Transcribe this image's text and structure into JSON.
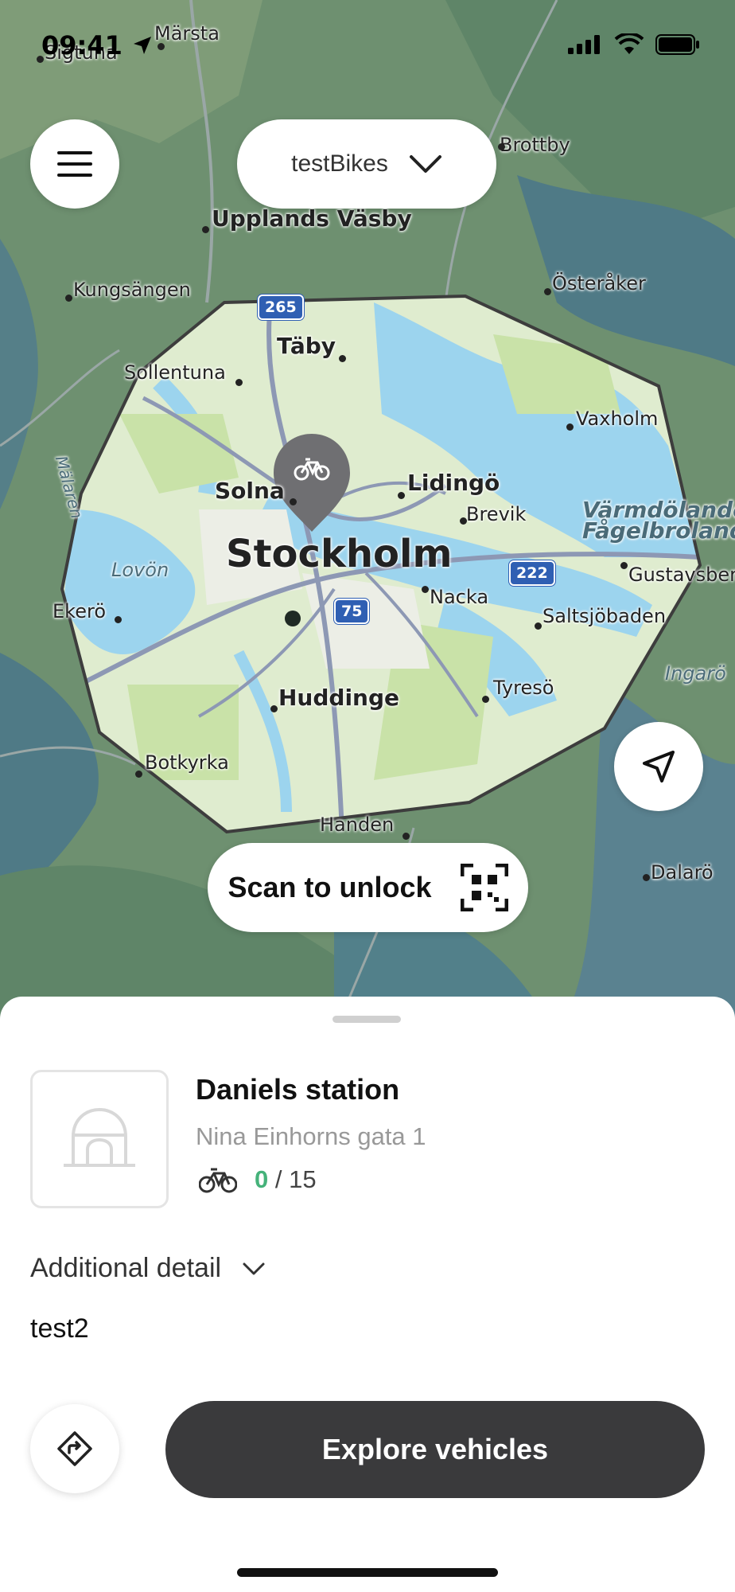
{
  "status_bar": {
    "time": "09:41"
  },
  "header": {
    "fleet_selector": "testBikes"
  },
  "map": {
    "places": [
      {
        "text": "Märsta",
        "cls": "small"
      },
      {
        "text": "Sigtuna",
        "cls": "small"
      },
      {
        "text": "Brottby",
        "cls": "small"
      },
      {
        "text": "Upplands Väsby",
        "cls": "med"
      },
      {
        "text": "Kungsängen",
        "cls": "small"
      },
      {
        "text": "Österåker",
        "cls": "small"
      },
      {
        "text": "Täby",
        "cls": "med"
      },
      {
        "text": "Sollentuna",
        "cls": "small"
      },
      {
        "text": "Vaxholm",
        "cls": "small"
      },
      {
        "text": "Solna",
        "cls": "med"
      },
      {
        "text": "Lidingö",
        "cls": "med"
      },
      {
        "text": "Brevik",
        "cls": "small"
      },
      {
        "text": "Värmdölandet",
        "cls": "med it"
      },
      {
        "text": "Fågelbrolandet",
        "cls": "med it"
      },
      {
        "text": "Stockholm",
        "cls": "big"
      },
      {
        "text": "Lovön",
        "cls": "small it"
      },
      {
        "text": "Gustavsberg",
        "cls": "small"
      },
      {
        "text": "Ekerö",
        "cls": "small"
      },
      {
        "text": "Nacka",
        "cls": "small"
      },
      {
        "text": "Saltsjöbaden",
        "cls": "small"
      },
      {
        "text": "Ingarö",
        "cls": "small it"
      },
      {
        "text": "Huddinge",
        "cls": "med"
      },
      {
        "text": "Tyresö",
        "cls": "small"
      },
      {
        "text": "Botkyrka",
        "cls": "small"
      },
      {
        "text": "Handen",
        "cls": "small"
      },
      {
        "text": "Dalarö",
        "cls": "small"
      },
      {
        "text": "Mälaren",
        "cls": "small it"
      }
    ],
    "road_shields": [
      "265",
      "222",
      "75"
    ]
  },
  "scan_button": {
    "label": "Scan to unlock"
  },
  "station": {
    "name": "Daniels station",
    "address": "Nina Einhorns gata 1",
    "available": "0",
    "capacity": "/ 15"
  },
  "additional_detail": {
    "label": "Additional detail",
    "value": "test2"
  },
  "explore_button": {
    "label": "Explore vehicles"
  },
  "colors": {
    "accent_green": "#45b27a",
    "button_dark": "#3a3a3c"
  }
}
